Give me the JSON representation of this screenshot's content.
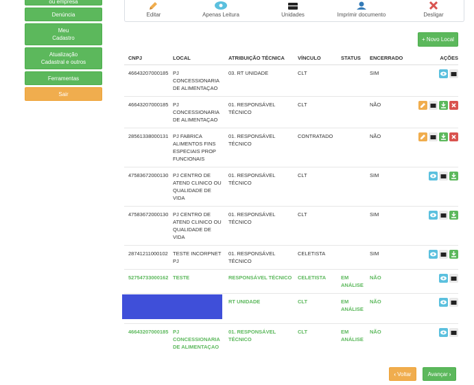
{
  "sidebar": {
    "items": [
      {
        "label": "ou empresa"
      },
      {
        "label": "Denúncia"
      },
      {
        "label": "Meu",
        "label2": "Cadastro"
      },
      {
        "label": "Atualização",
        "label2": "Cadastral e outros"
      },
      {
        "label": "Ferramentas"
      },
      {
        "label": "Sair"
      }
    ]
  },
  "toolbar": {
    "editar": "Editar",
    "apenas_leitura": "Apenas Leitura",
    "unidades": "Unidades",
    "imprimir": "Imprimir documento",
    "desligar": "Desligar"
  },
  "novo_local": "+ Novo Local",
  "table": {
    "headers": [
      "CNPJ",
      "LOCAL",
      "ATRIBUIÇÃO TÉCNICA",
      "VÍNCULO",
      "STATUS",
      "ENCERRADO",
      "AÇÕES"
    ],
    "rows": [
      {
        "cnpj": "46643207000185",
        "local": "PJ CONCESSIONARIA DE ALIMENTAÇAO",
        "atrib": "03. RT UNIDADE",
        "vinculo": "CLT",
        "status": "",
        "encerrado": "SIM"
      },
      {
        "cnpj": "46643207000185",
        "local": "PJ CONCESSIONARIA DE ALIMENTAÇAO",
        "atrib": "01. RESPONSÁVEL TÉCNICO",
        "vinculo": "CLT",
        "status": "",
        "encerrado": "NÃO"
      },
      {
        "cnpj": "28561338000131",
        "local": "PJ FABRICA ALIMENTOS FINS ESPECIAIS PROP FUNCIONAIS",
        "atrib": "01. RESPONSÁVEL TÉCNICO",
        "vinculo": "CONTRATADO",
        "status": "",
        "encerrado": "NÃO"
      },
      {
        "cnpj": "47583672000130",
        "local": "PJ CENTRO DE ATEND CLINICO OU QUALIDADE DE VIDA",
        "atrib": "01. RESPONSÁVEL TÉCNICO",
        "vinculo": "CLT",
        "status": "",
        "encerrado": "SIM"
      },
      {
        "cnpj": "47583672000130",
        "local": "PJ CENTRO DE ATEND CLINICO OU QUALIDADE DE VIDA",
        "atrib": "01. RESPONSÁVEL TÉCNICO",
        "vinculo": "CLT",
        "status": "",
        "encerrado": "SIM"
      },
      {
        "cnpj": "28741211000102",
        "local": "TESTE INCORPNET PJ",
        "atrib": "01. RESPONSÁVEL TÉCNICO",
        "vinculo": "CELETISTA",
        "status": "",
        "encerrado": "SIM"
      },
      {
        "cnpj": "52754733000162",
        "local": "TESTE",
        "atrib": "RESPONSÁVEL TÉCNICO",
        "vinculo": "CELETISTA",
        "status": "EM ANÁLISE",
        "encerrado": "NÃO"
      },
      {
        "cnpj": "",
        "local": "",
        "atrib": "RT UNIDADE",
        "vinculo": "CLT",
        "status": "EM ANÁLISE",
        "encerrado": "NÃO"
      },
      {
        "cnpj": "46643207000185",
        "local": "PJ CONCESSIONARIA DE ALIMENTAÇAO",
        "atrib": "01. RESPONSÁVEL TÉCNICO",
        "vinculo": "CLT",
        "status": "EM ANÁLISE",
        "encerrado": "NÃO"
      }
    ]
  },
  "footer": {
    "voltar": "Voltar",
    "avancar": "Avançar"
  },
  "colors": {
    "green": "#5cb85c",
    "orange": "#f0ad4e",
    "info": "#5bc0de",
    "danger": "#d9534f",
    "redacted": "#3f4fd9"
  }
}
